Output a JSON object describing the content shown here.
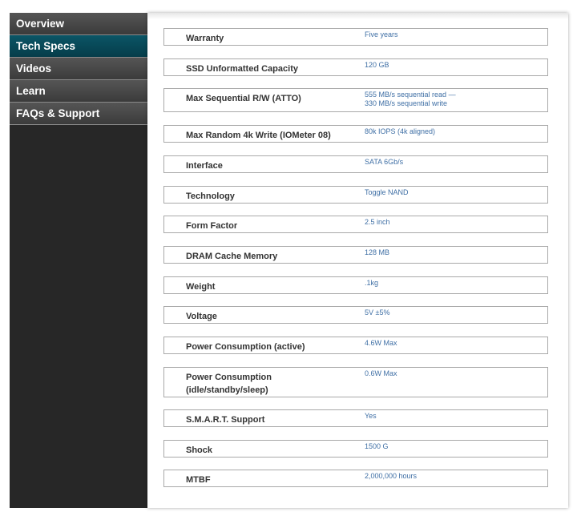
{
  "nav": {
    "items": [
      {
        "label": "Overview",
        "active": false
      },
      {
        "label": "Tech Specs",
        "active": true
      },
      {
        "label": "Videos",
        "active": false
      },
      {
        "label": "Learn",
        "active": false
      },
      {
        "label": "FAQs & Support",
        "active": false
      }
    ]
  },
  "specs": [
    {
      "label": "Warranty",
      "value": "Five years"
    },
    {
      "label": "SSD Unformatted Capacity",
      "value": "120 GB"
    },
    {
      "label": "Max Sequential R/W (ATTO)",
      "value": "555 MB/s sequential read —",
      "value2": "330 MB/s sequential write"
    },
    {
      "label": "Max Random 4k Write (IOMeter 08)",
      "value": "80k IOPS (4k aligned)"
    },
    {
      "label": "Interface",
      "value": "SATA 6Gb/s"
    },
    {
      "label": "Technology",
      "value": "Toggle NAND"
    },
    {
      "label": "Form Factor",
      "value": "2.5 inch"
    },
    {
      "label": "DRAM Cache Memory",
      "value": "128 MB"
    },
    {
      "label": "Weight",
      "value": ".1kg"
    },
    {
      "label": "Voltage",
      "value": "5V ±5%"
    },
    {
      "label": "Power Consumption (active)",
      "value": "4.6W Max"
    },
    {
      "label": "Power Consumption",
      "label2": "(idle/standby/sleep)",
      "value": "0.6W Max"
    },
    {
      "label": "S.M.A.R.T. Support",
      "value": "Yes"
    },
    {
      "label": "Shock",
      "value": "1500 G"
    },
    {
      "label": "MTBF",
      "value": "2,000,000 hours"
    }
  ],
  "colors": {
    "sidebar_bg": "#272727",
    "active_tab": "#0b5566",
    "value_text": "#3f6fa5",
    "label_text": "#333333"
  }
}
